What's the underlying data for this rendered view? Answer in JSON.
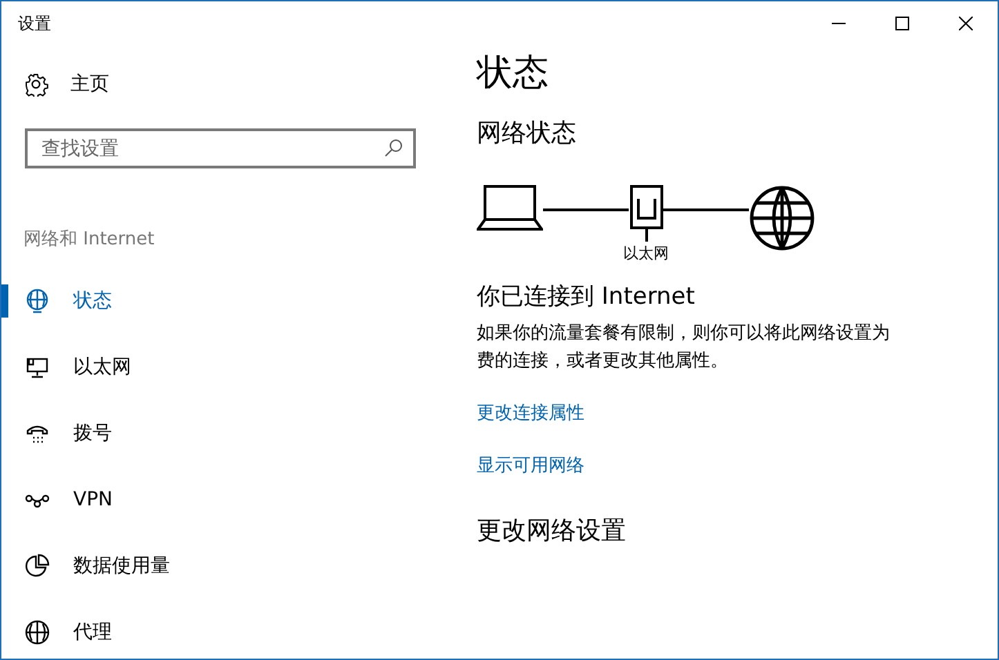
{
  "window": {
    "title": "设置"
  },
  "sidebar": {
    "home": "主页",
    "search": {
      "placeholder": "查找设置"
    },
    "section": "网络和 Internet",
    "items": [
      {
        "label": "状态",
        "kind": "status",
        "selected": true
      },
      {
        "label": "以太网",
        "kind": "ethernet",
        "selected": false
      },
      {
        "label": "拨号",
        "kind": "dialup",
        "selected": false
      },
      {
        "label": "VPN",
        "kind": "vpn",
        "selected": false
      },
      {
        "label": "数据使用量",
        "kind": "data",
        "selected": false
      },
      {
        "label": "代理",
        "kind": "proxy",
        "selected": false
      }
    ]
  },
  "content": {
    "title": "状态",
    "network_heading": "网络状态",
    "adapter_label": "以太网",
    "connected": "你已连接到 Internet",
    "description": [
      "如果你的流量套餐有限制，则你可以将此网络设置为",
      "费的连接，或者更改其他属性。"
    ],
    "links": [
      "更改连接属性",
      "显示可用网络"
    ],
    "change_heading": "更改网络设置"
  }
}
